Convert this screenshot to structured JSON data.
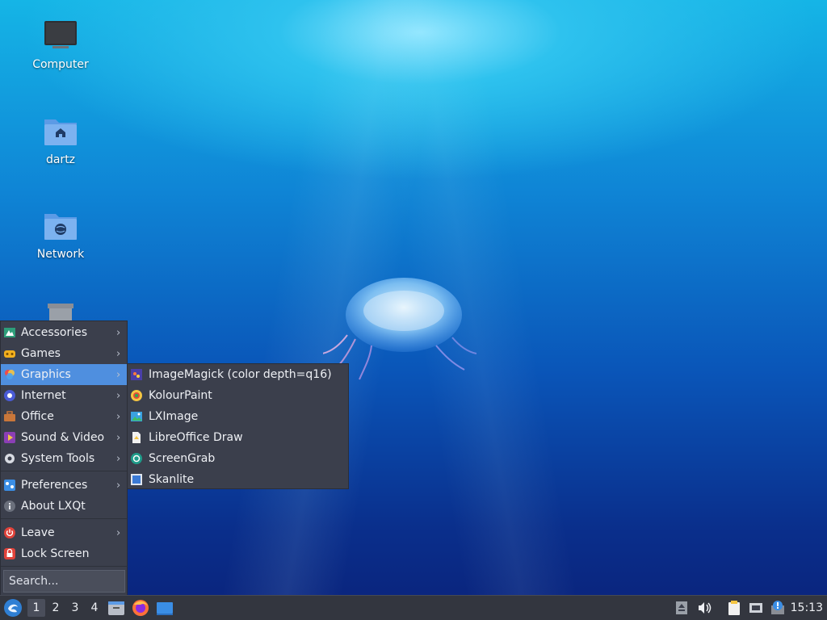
{
  "desktop": {
    "icons": [
      {
        "label": "Computer",
        "icon": "computer-icon"
      },
      {
        "label": "dartz",
        "icon": "home-folder-icon"
      },
      {
        "label": "Network",
        "icon": "network-folder-icon"
      },
      {
        "label": "",
        "icon": "trash-icon"
      }
    ]
  },
  "menu": {
    "items": [
      {
        "label": "Accessories",
        "icon": "accessories-icon",
        "has_submenu": true
      },
      {
        "label": "Games",
        "icon": "games-icon",
        "has_submenu": true
      },
      {
        "label": "Graphics",
        "icon": "graphics-icon",
        "has_submenu": true,
        "active": true
      },
      {
        "label": "Internet",
        "icon": "internet-icon",
        "has_submenu": true
      },
      {
        "label": "Office",
        "icon": "office-icon",
        "has_submenu": true
      },
      {
        "label": "Sound & Video",
        "icon": "sound-video-icon",
        "has_submenu": true
      },
      {
        "label": "System Tools",
        "icon": "system-tools-icon",
        "has_submenu": true
      },
      {
        "label": "Preferences",
        "icon": "preferences-icon",
        "has_submenu": true
      },
      {
        "label": "About LXQt",
        "icon": "info-icon",
        "has_submenu": false
      },
      {
        "label": "Leave",
        "icon": "power-icon",
        "has_submenu": true
      },
      {
        "label": "Lock Screen",
        "icon": "lock-icon",
        "has_submenu": false
      }
    ],
    "search_placeholder": "Search..."
  },
  "submenu": {
    "parent": "Graphics",
    "items": [
      {
        "label": "ImageMagick (color depth=q16)",
        "icon": "imagemagick-icon"
      },
      {
        "label": "KolourPaint",
        "icon": "kolourpaint-icon"
      },
      {
        "label": "LXImage",
        "icon": "lximage-icon"
      },
      {
        "label": "LibreOffice Draw",
        "icon": "libreoffice-draw-icon"
      },
      {
        "label": "ScreenGrab",
        "icon": "screengrab-icon"
      },
      {
        "label": "Skanlite",
        "icon": "skanlite-icon"
      }
    ]
  },
  "taskbar": {
    "workspaces": [
      "1",
      "2",
      "3",
      "4"
    ],
    "active_workspace": "1",
    "quicklaunch": [
      "file-manager-icon",
      "firefox-icon",
      "show-desktop-icon"
    ],
    "tray": [
      "removable-media-icon",
      "volume-icon",
      "clipboard-icon",
      "network-wired-icon",
      "update-notifier-icon"
    ],
    "clock": "15:13"
  },
  "colors": {
    "menu_bg": "#3b3f4c",
    "menu_active": "#4f8fdf",
    "taskbar_bg": "#33363f"
  }
}
